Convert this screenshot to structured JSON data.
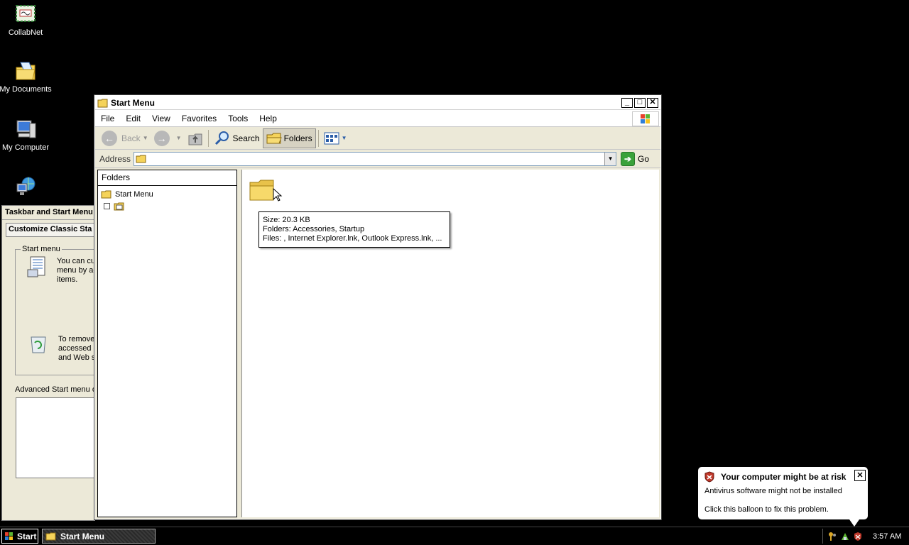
{
  "desktop": {
    "icons": [
      {
        "label": "CollabNet",
        "icon": "collabnet-icon"
      },
      {
        "label": "My Documents",
        "icon": "my-documents-icon"
      },
      {
        "label": "My Computer",
        "icon": "my-computer-icon"
      },
      {
        "label": "",
        "icon": "network-icon"
      }
    ]
  },
  "bg_dialog": {
    "title": "Taskbar and Start Menu",
    "subtitle": "Customize Classic Sta",
    "group_title": "Start menu",
    "text1": [
      "You can cu",
      "menu by ac",
      "items."
    ],
    "text2": [
      "To remove",
      "accessed c",
      "and Web s"
    ],
    "advanced_label": "Advanced Start menu o"
  },
  "window": {
    "title": "Start Menu",
    "controls": {
      "minimize": "_",
      "maximize": "□",
      "close": "✕"
    },
    "menu": [
      "File",
      "Edit",
      "View",
      "Favorites",
      "Tools",
      "Help"
    ],
    "toolbar": {
      "back": "Back",
      "search": "Search",
      "folders": "Folders"
    },
    "address": {
      "label": "Address",
      "value": "",
      "go": "Go"
    },
    "folders_pane": {
      "header": "Folders",
      "tree": [
        {
          "label": "Start Menu"
        },
        {
          "label": ""
        }
      ]
    },
    "tooltip": {
      "size": "Size: 20.3 KB",
      "folders": "Folders: Accessories, Startup",
      "files": "Files: , Internet Explorer.lnk, Outlook Express.lnk, ..."
    }
  },
  "balloon": {
    "title": "Your computer might be at risk",
    "line1": "Antivirus software might not be installed",
    "line2": "Click this balloon to fix this problem.",
    "close": "✕"
  },
  "taskbar": {
    "start": "Start",
    "task_item": "Start Menu",
    "clock": "3:57 AM"
  },
  "colors": {
    "desktop": "#000000",
    "window_face": "#ece9d8",
    "go_green": "#3aa23a",
    "folder_yellow": "#f5d35a"
  }
}
